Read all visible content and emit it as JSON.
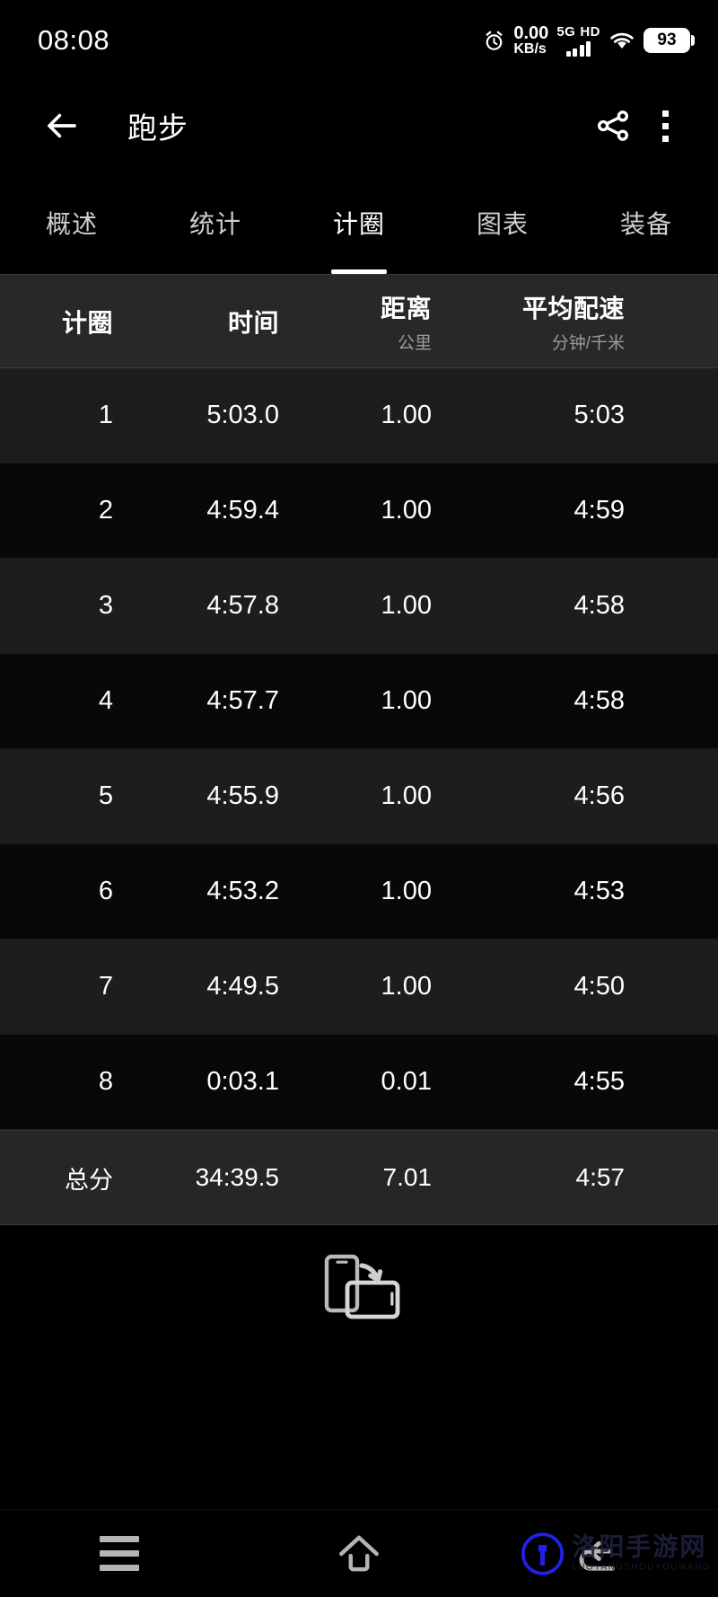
{
  "status_bar": {
    "clock": "08:08",
    "alarm_icon": "alarm-clock-icon",
    "net_speed_value": "0.00",
    "net_speed_unit": "KB/s",
    "network_type": "5G",
    "hd_label": "HD",
    "signal_icon": "signal-bars-icon",
    "wifi_icon": "wifi-icon",
    "battery_percent": "93"
  },
  "app_bar": {
    "back_icon": "back-arrow-icon",
    "title": "跑步",
    "share_icon": "share-icon",
    "overflow_icon": "more-vertical-icon"
  },
  "tabs": {
    "active_index": 2,
    "items": [
      {
        "label": "概述"
      },
      {
        "label": "统计"
      },
      {
        "label": "计圈"
      },
      {
        "label": "图表"
      },
      {
        "label": "装备"
      }
    ]
  },
  "laps_table": {
    "columns": [
      {
        "title": "计圈",
        "unit": ""
      },
      {
        "title": "时间",
        "unit": ""
      },
      {
        "title": "距离",
        "unit": "公里"
      },
      {
        "title": "平均配速",
        "unit": "分钟/千米"
      }
    ],
    "rows": [
      {
        "lap": "1",
        "time": "5:03.0",
        "distance": "1.00",
        "pace": "5:03"
      },
      {
        "lap": "2",
        "time": "4:59.4",
        "distance": "1.00",
        "pace": "4:59"
      },
      {
        "lap": "3",
        "time": "4:57.8",
        "distance": "1.00",
        "pace": "4:58"
      },
      {
        "lap": "4",
        "time": "4:57.7",
        "distance": "1.00",
        "pace": "4:58"
      },
      {
        "lap": "5",
        "time": "4:55.9",
        "distance": "1.00",
        "pace": "4:56"
      },
      {
        "lap": "6",
        "time": "4:53.2",
        "distance": "1.00",
        "pace": "4:53"
      },
      {
        "lap": "7",
        "time": "4:49.5",
        "distance": "1.00",
        "pace": "4:50"
      },
      {
        "lap": "8",
        "time": "0:03.1",
        "distance": "0.01",
        "pace": "4:55"
      }
    ],
    "totals": {
      "lap": "总分",
      "time": "34:39.5",
      "distance": "7.01",
      "pace": "4:57"
    }
  },
  "rotate_hint": {
    "icon": "screen-rotation-icon"
  },
  "nav_bar": {
    "menu_icon": "menu-icon",
    "home_icon": "home-icon",
    "back_icon": "back-icon"
  },
  "watermark": {
    "logo_icon": "site-logo-icon",
    "cn_text": "洛阳手游网",
    "en_text": "LUOYANGSHOUYOUWANG"
  },
  "colors": {
    "background": "#000000",
    "header_band": "#282828",
    "row_odd": "#1d1d1d",
    "row_even": "#080808",
    "totals_band": "#262626",
    "accent": "#ffffff",
    "muted_text": "#9a9a9a",
    "watermark_blue": "#1f1f3d"
  }
}
